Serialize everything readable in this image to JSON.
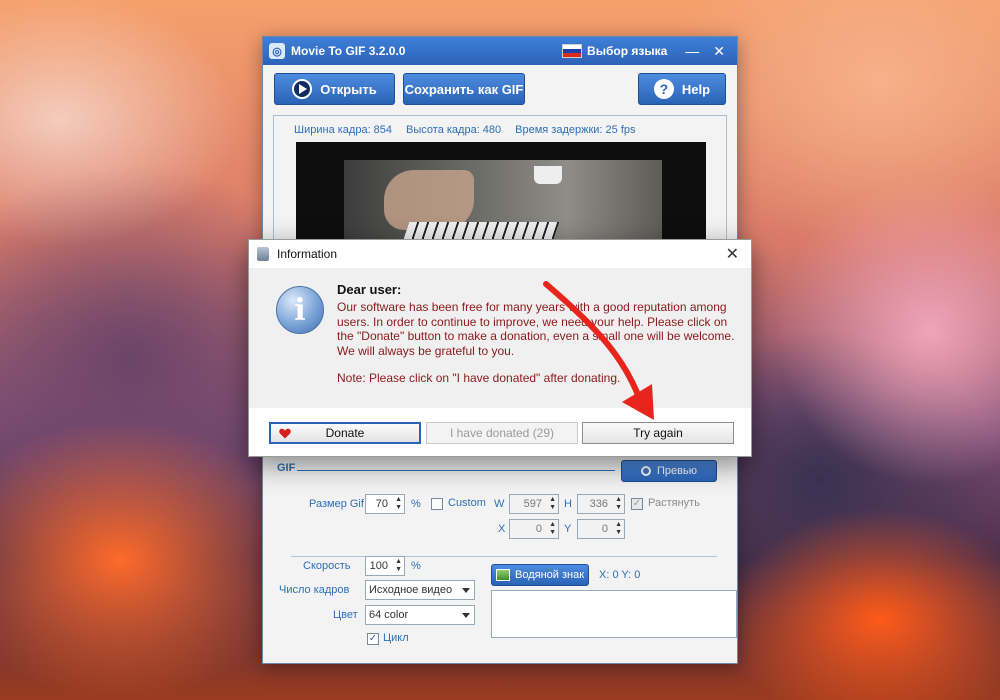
{
  "app": {
    "title": "Movie To GIF 3.2.0.0",
    "language_label": "Выбор языка",
    "toolbar": {
      "open_label": "Открыть",
      "save_label": "Сохранить как GIF",
      "help_label": "Help"
    },
    "frame_info": {
      "width": "Ширина кадра: 854",
      "height": "Высота кадра: 480",
      "delay": "Время задержки: 25 fps"
    },
    "gif": {
      "section_title": "GIF",
      "preview_label": "Превью",
      "size_label": "Размер Gif",
      "size_value": "70",
      "percent": "%",
      "custom_label": "Custom",
      "w_label": "W",
      "w_value": "597",
      "h_label": "H",
      "h_value": "336",
      "stretch_label": "Растянуть",
      "x_label": "X",
      "x_value": "0",
      "y_label": "Y",
      "y_value": "0",
      "speed_label": "Скорость",
      "speed_value": "100",
      "speed_percent": "%",
      "frames_label": "Число кадров",
      "frames_value": "Исходное видео",
      "color_label": "Цвет",
      "color_value": "64 color",
      "loop_label": "Цикл",
      "watermark_label": "Водяной знак",
      "watermark_coords": "X: 0  Y: 0"
    }
  },
  "dialog": {
    "title": "Information",
    "heading": "Dear user:",
    "message": "Our software has been free for many years with a good reputation among users. In order to continue to improve, we need your help. Please click on the \"Donate\" button to make a donation, even a small one will be welcome. We will always be grateful to you.",
    "note": "Note: Please click on \"I have donated\" after donating.",
    "donate_label": "Donate",
    "donated_label": "I have donated (29)",
    "try_again_label": "Try again"
  },
  "colors": {
    "accent": "#2a63b6",
    "message_text": "#8b1a1a",
    "annotation_arrow": "#e8251c"
  }
}
